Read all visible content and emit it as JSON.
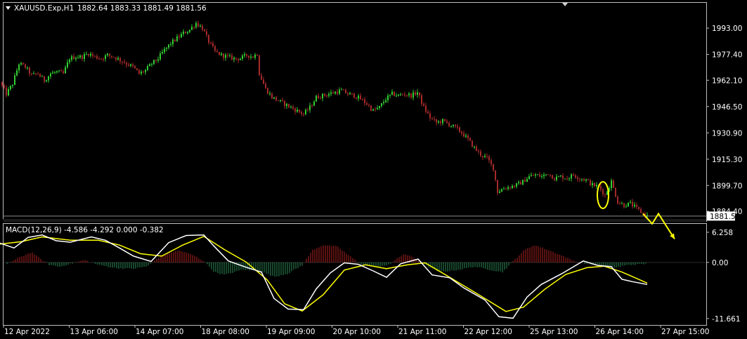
{
  "chart_data": [
    {
      "type": "candlestick",
      "symbol_label": "XAUUSD.Exp,H1",
      "ohlc_label": "1882.64 1883.33 1881.49 1881.56",
      "y_ticks": [
        "1993.00",
        "1977.40",
        "1962.10",
        "1946.50",
        "1930.90",
        "1915.30",
        "1899.70",
        "1884.40"
      ],
      "y_tick_values": [
        1993.0,
        1977.4,
        1962.1,
        1946.5,
        1930.9,
        1915.3,
        1899.7,
        1884.4
      ],
      "ylim": [
        1878.6,
        2008.0
      ],
      "current_price_label": "1881.56",
      "current_price": 1881.56,
      "x_tick_labels": [
        "12 Apr 2022",
        "13 Apr 06:00",
        "14 Apr 07:00",
        "18 Apr 08:00",
        "19 Apr 09:00",
        "20 Apr 10:00",
        "21 Apr 11:00",
        "22 Apr 12:00",
        "25 Apr 13:00",
        "26 Apr 14:00",
        "27 Apr 15:00"
      ],
      "colors": {
        "bull": "#32cd32",
        "bear": "#a52a2a",
        "background": "#000000",
        "annotation": "#ffff00"
      },
      "close_path": [
        [
          0,
          1961
        ],
        [
          9,
          1954
        ],
        [
          18,
          1960
        ],
        [
          27,
          1972
        ],
        [
          36,
          1970
        ],
        [
          45,
          1965
        ],
        [
          54,
          1966
        ],
        [
          63,
          1962
        ],
        [
          72,
          1966
        ],
        [
          81,
          1967
        ],
        [
          90,
          1966
        ],
        [
          99,
          1975
        ],
        [
          108,
          1976
        ],
        [
          117,
          1976
        ],
        [
          126,
          1978
        ],
        [
          135,
          1976
        ],
        [
          144,
          1975
        ],
        [
          153,
          1977
        ],
        [
          162,
          1976
        ],
        [
          171,
          1974
        ],
        [
          180,
          1972
        ],
        [
          189,
          1970
        ],
        [
          198,
          1966
        ],
        [
          207,
          1968
        ],
        [
          216,
          1972
        ],
        [
          225,
          1975
        ],
        [
          234,
          1980
        ],
        [
          243,
          1984
        ],
        [
          252,
          1987
        ],
        [
          261,
          1990
        ],
        [
          270,
          1992
        ],
        [
          279,
          1996
        ],
        [
          288,
          1993
        ],
        [
          297,
          1985
        ],
        [
          306,
          1979
        ],
        [
          315,
          1977
        ],
        [
          324,
          1976
        ],
        [
          333,
          1975
        ],
        [
          342,
          1975
        ],
        [
          351,
          1977
        ],
        [
          360,
          1976
        ],
        [
          366,
          1978
        ],
        [
          369,
          1966
        ],
        [
          378,
          1957
        ],
        [
          387,
          1952
        ],
        [
          396,
          1950
        ],
        [
          405,
          1948
        ],
        [
          414,
          1946
        ],
        [
          423,
          1944
        ],
        [
          432,
          1942
        ],
        [
          441,
          1946
        ],
        [
          450,
          1952
        ],
        [
          459,
          1953
        ],
        [
          468,
          1954
        ],
        [
          477,
          1955
        ],
        [
          486,
          1956
        ],
        [
          495,
          1954
        ],
        [
          504,
          1953
        ],
        [
          513,
          1951
        ],
        [
          522,
          1948
        ],
        [
          531,
          1944
        ],
        [
          540,
          1946
        ],
        [
          549,
          1951
        ],
        [
          558,
          1954
        ],
        [
          567,
          1953
        ],
        [
          576,
          1954
        ],
        [
          585,
          1953
        ],
        [
          594,
          1955
        ],
        [
          603,
          1946
        ],
        [
          612,
          1940
        ],
        [
          621,
          1937
        ],
        [
          630,
          1938
        ],
        [
          639,
          1936
        ],
        [
          648,
          1934
        ],
        [
          657,
          1931
        ],
        [
          666,
          1927
        ],
        [
          675,
          1922
        ],
        [
          684,
          1918
        ],
        [
          693,
          1916
        ],
        [
          702,
          1910
        ],
        [
          708,
          1896
        ],
        [
          717,
          1898
        ],
        [
          726,
          1899
        ],
        [
          735,
          1900
        ],
        [
          744,
          1902
        ],
        [
          753,
          1905
        ],
        [
          762,
          1906
        ],
        [
          771,
          1905
        ],
        [
          780,
          1907
        ],
        [
          789,
          1904
        ],
        [
          798,
          1905
        ],
        [
          807,
          1904
        ],
        [
          816,
          1906
        ],
        [
          825,
          1904
        ],
        [
          834,
          1903
        ],
        [
          843,
          1900
        ],
        [
          852,
          1899
        ],
        [
          861,
          1894
        ],
        [
          870,
          1902
        ],
        [
          879,
          1890
        ],
        [
          888,
          1888
        ],
        [
          897,
          1889
        ],
        [
          906,
          1886
        ],
        [
          915,
          1883
        ],
        [
          921,
          1881.56
        ]
      ],
      "annotations": {
        "oval_center": [
          858,
          1894
        ],
        "arrow_path": [
          [
            915,
            1883
          ],
          [
            928,
            1877
          ],
          [
            937,
            1883
          ],
          [
            960,
            1868
          ]
        ]
      }
    },
    {
      "type": "macd",
      "indicator_label": "MACD(12,26,9) -4.586 -4.292 0.000 -0.382",
      "y_ticks": [
        "6.258",
        "0.00",
        "-11.661"
      ],
      "y_tick_values": [
        6.258,
        0.0,
        -11.661
      ],
      "ylim": [
        -13.0,
        8.0
      ],
      "colors": {
        "macd": "#ffffff",
        "signal": "#ffff00",
        "hist_pos": "#b22222",
        "hist_neg": "#2e8b57"
      },
      "macd": [
        [
          0,
          4.0
        ],
        [
          20,
          3.0
        ],
        [
          40,
          5.2
        ],
        [
          60,
          5.7
        ],
        [
          80,
          4.5
        ],
        [
          100,
          4.2
        ],
        [
          130,
          5.3
        ],
        [
          150,
          4.6
        ],
        [
          170,
          3.0
        ],
        [
          190,
          1.3
        ],
        [
          215,
          0.2
        ],
        [
          240,
          4.1
        ],
        [
          265,
          5.6
        ],
        [
          290,
          5.7
        ],
        [
          305,
          3.3
        ],
        [
          325,
          0.3
        ],
        [
          350,
          -1.0
        ],
        [
          372,
          -2.0
        ],
        [
          390,
          -7.5
        ],
        [
          410,
          -9.7
        ],
        [
          432,
          -9.8
        ],
        [
          450,
          -5.5
        ],
        [
          470,
          -2.2
        ],
        [
          490,
          -0.1
        ],
        [
          510,
          -0.4
        ],
        [
          530,
          -1.7
        ],
        [
          550,
          -3.1
        ],
        [
          570,
          -0.3
        ],
        [
          595,
          0.7
        ],
        [
          615,
          -2.6
        ],
        [
          640,
          -3.2
        ],
        [
          660,
          -5.3
        ],
        [
          690,
          -7.8
        ],
        [
          710,
          -11.3
        ],
        [
          730,
          -11.6
        ],
        [
          750,
          -7.2
        ],
        [
          770,
          -4.6
        ],
        [
          800,
          -2.3
        ],
        [
          830,
          0.3
        ],
        [
          850,
          -0.6
        ],
        [
          870,
          -0.9
        ],
        [
          885,
          -3.5
        ],
        [
          900,
          -4.0
        ],
        [
          921,
          -4.586
        ]
      ],
      "signal": [
        [
          0,
          3.8
        ],
        [
          30,
          4.3
        ],
        [
          60,
          5.3
        ],
        [
          100,
          4.6
        ],
        [
          140,
          4.6
        ],
        [
          170,
          3.6
        ],
        [
          200,
          1.8
        ],
        [
          230,
          1.3
        ],
        [
          260,
          3.6
        ],
        [
          290,
          5.4
        ],
        [
          320,
          2.6
        ],
        [
          350,
          0.1
        ],
        [
          380,
          -3.6
        ],
        [
          405,
          -8.6
        ],
        [
          430,
          -10.1
        ],
        [
          460,
          -6.7
        ],
        [
          490,
          -1.6
        ],
        [
          520,
          -0.5
        ],
        [
          550,
          -1.3
        ],
        [
          580,
          -0.5
        ],
        [
          605,
          -0.1
        ],
        [
          640,
          -3.1
        ],
        [
          680,
          -6.6
        ],
        [
          720,
          -10.2
        ],
        [
          745,
          -9.3
        ],
        [
          775,
          -5.6
        ],
        [
          805,
          -2.5
        ],
        [
          835,
          -1.1
        ],
        [
          860,
          -0.8
        ],
        [
          885,
          -2.0
        ],
        [
          921,
          -4.292
        ]
      ],
      "histogram": [
        [
          10,
          -0.3
        ],
        [
          30,
          1.2
        ],
        [
          45,
          2.1
        ],
        [
          55,
          1.0
        ],
        [
          70,
          -0.5
        ],
        [
          85,
          -0.9
        ],
        [
          100,
          -0.3
        ],
        [
          120,
          0.5
        ],
        [
          140,
          -0.5
        ],
        [
          165,
          -1.2
        ],
        [
          190,
          -1.3
        ],
        [
          210,
          -0.8
        ],
        [
          230,
          1.5
        ],
        [
          255,
          2.5
        ],
        [
          275,
          1.5
        ],
        [
          290,
          0.3
        ],
        [
          305,
          -2.0
        ],
        [
          320,
          -2.6
        ],
        [
          345,
          -1.5
        ],
        [
          370,
          -1.8
        ],
        [
          390,
          -3.0
        ],
        [
          410,
          -2.3
        ],
        [
          430,
          -0.6
        ],
        [
          445,
          2.6
        ],
        [
          460,
          3.6
        ],
        [
          480,
          3.3
        ],
        [
          495,
          1.6
        ],
        [
          515,
          -0.5
        ],
        [
          540,
          -1.0
        ],
        [
          555,
          -0.3
        ],
        [
          575,
          1.8
        ],
        [
          590,
          0.9
        ],
        [
          605,
          -0.6
        ],
        [
          625,
          -2.0
        ],
        [
          650,
          -1.6
        ],
        [
          675,
          -0.9
        ],
        [
          700,
          -1.6
        ],
        [
          715,
          -2.0
        ],
        [
          730,
          0.2
        ],
        [
          745,
          2.4
        ],
        [
          760,
          3.6
        ],
        [
          780,
          2.6
        ],
        [
          800,
          1.4
        ],
        [
          815,
          0.4
        ],
        [
          835,
          -0.3
        ],
        [
          855,
          -0.6
        ],
        [
          875,
          -1.1
        ],
        [
          895,
          -0.5
        ],
        [
          921,
          -0.3
        ]
      ]
    }
  ]
}
